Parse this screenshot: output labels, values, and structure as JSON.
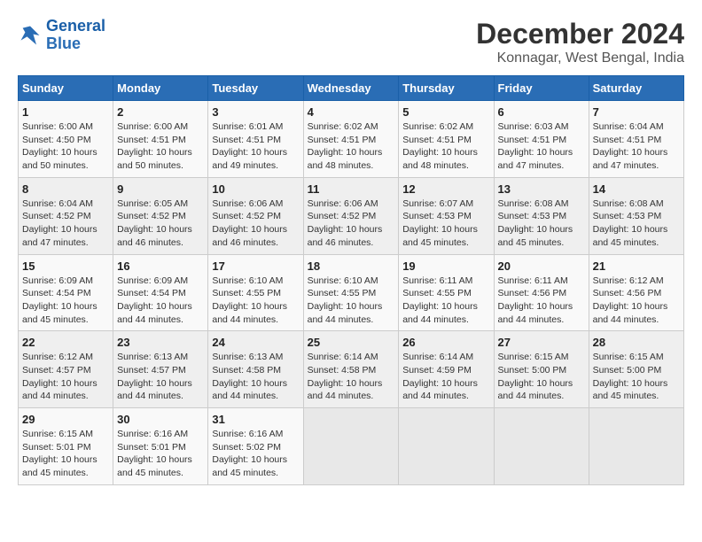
{
  "logo": {
    "line1": "General",
    "line2": "Blue"
  },
  "title": "December 2024",
  "subtitle": "Konnagar, West Bengal, India",
  "weekdays": [
    "Sunday",
    "Monday",
    "Tuesday",
    "Wednesday",
    "Thursday",
    "Friday",
    "Saturday"
  ],
  "weeks": [
    [
      {
        "day": "1",
        "sunrise": "6:00 AM",
        "sunset": "4:50 PM",
        "daylight": "10 hours and 50 minutes."
      },
      {
        "day": "2",
        "sunrise": "6:00 AM",
        "sunset": "4:51 PM",
        "daylight": "10 hours and 50 minutes."
      },
      {
        "day": "3",
        "sunrise": "6:01 AM",
        "sunset": "4:51 PM",
        "daylight": "10 hours and 49 minutes."
      },
      {
        "day": "4",
        "sunrise": "6:02 AM",
        "sunset": "4:51 PM",
        "daylight": "10 hours and 48 minutes."
      },
      {
        "day": "5",
        "sunrise": "6:02 AM",
        "sunset": "4:51 PM",
        "daylight": "10 hours and 48 minutes."
      },
      {
        "day": "6",
        "sunrise": "6:03 AM",
        "sunset": "4:51 PM",
        "daylight": "10 hours and 47 minutes."
      },
      {
        "day": "7",
        "sunrise": "6:04 AM",
        "sunset": "4:51 PM",
        "daylight": "10 hours and 47 minutes."
      }
    ],
    [
      {
        "day": "8",
        "sunrise": "6:04 AM",
        "sunset": "4:52 PM",
        "daylight": "10 hours and 47 minutes."
      },
      {
        "day": "9",
        "sunrise": "6:05 AM",
        "sunset": "4:52 PM",
        "daylight": "10 hours and 46 minutes."
      },
      {
        "day": "10",
        "sunrise": "6:06 AM",
        "sunset": "4:52 PM",
        "daylight": "10 hours and 46 minutes."
      },
      {
        "day": "11",
        "sunrise": "6:06 AM",
        "sunset": "4:52 PM",
        "daylight": "10 hours and 46 minutes."
      },
      {
        "day": "12",
        "sunrise": "6:07 AM",
        "sunset": "4:53 PM",
        "daylight": "10 hours and 45 minutes."
      },
      {
        "day": "13",
        "sunrise": "6:08 AM",
        "sunset": "4:53 PM",
        "daylight": "10 hours and 45 minutes."
      },
      {
        "day": "14",
        "sunrise": "6:08 AM",
        "sunset": "4:53 PM",
        "daylight": "10 hours and 45 minutes."
      }
    ],
    [
      {
        "day": "15",
        "sunrise": "6:09 AM",
        "sunset": "4:54 PM",
        "daylight": "10 hours and 45 minutes."
      },
      {
        "day": "16",
        "sunrise": "6:09 AM",
        "sunset": "4:54 PM",
        "daylight": "10 hours and 44 minutes."
      },
      {
        "day": "17",
        "sunrise": "6:10 AM",
        "sunset": "4:55 PM",
        "daylight": "10 hours and 44 minutes."
      },
      {
        "day": "18",
        "sunrise": "6:10 AM",
        "sunset": "4:55 PM",
        "daylight": "10 hours and 44 minutes."
      },
      {
        "day": "19",
        "sunrise": "6:11 AM",
        "sunset": "4:55 PM",
        "daylight": "10 hours and 44 minutes."
      },
      {
        "day": "20",
        "sunrise": "6:11 AM",
        "sunset": "4:56 PM",
        "daylight": "10 hours and 44 minutes."
      },
      {
        "day": "21",
        "sunrise": "6:12 AM",
        "sunset": "4:56 PM",
        "daylight": "10 hours and 44 minutes."
      }
    ],
    [
      {
        "day": "22",
        "sunrise": "6:12 AM",
        "sunset": "4:57 PM",
        "daylight": "10 hours and 44 minutes."
      },
      {
        "day": "23",
        "sunrise": "6:13 AM",
        "sunset": "4:57 PM",
        "daylight": "10 hours and 44 minutes."
      },
      {
        "day": "24",
        "sunrise": "6:13 AM",
        "sunset": "4:58 PM",
        "daylight": "10 hours and 44 minutes."
      },
      {
        "day": "25",
        "sunrise": "6:14 AM",
        "sunset": "4:58 PM",
        "daylight": "10 hours and 44 minutes."
      },
      {
        "day": "26",
        "sunrise": "6:14 AM",
        "sunset": "4:59 PM",
        "daylight": "10 hours and 44 minutes."
      },
      {
        "day": "27",
        "sunrise": "6:15 AM",
        "sunset": "5:00 PM",
        "daylight": "10 hours and 44 minutes."
      },
      {
        "day": "28",
        "sunrise": "6:15 AM",
        "sunset": "5:00 PM",
        "daylight": "10 hours and 45 minutes."
      }
    ],
    [
      {
        "day": "29",
        "sunrise": "6:15 AM",
        "sunset": "5:01 PM",
        "daylight": "10 hours and 45 minutes."
      },
      {
        "day": "30",
        "sunrise": "6:16 AM",
        "sunset": "5:01 PM",
        "daylight": "10 hours and 45 minutes."
      },
      {
        "day": "31",
        "sunrise": "6:16 AM",
        "sunset": "5:02 PM",
        "daylight": "10 hours and 45 minutes."
      },
      null,
      null,
      null,
      null
    ]
  ]
}
